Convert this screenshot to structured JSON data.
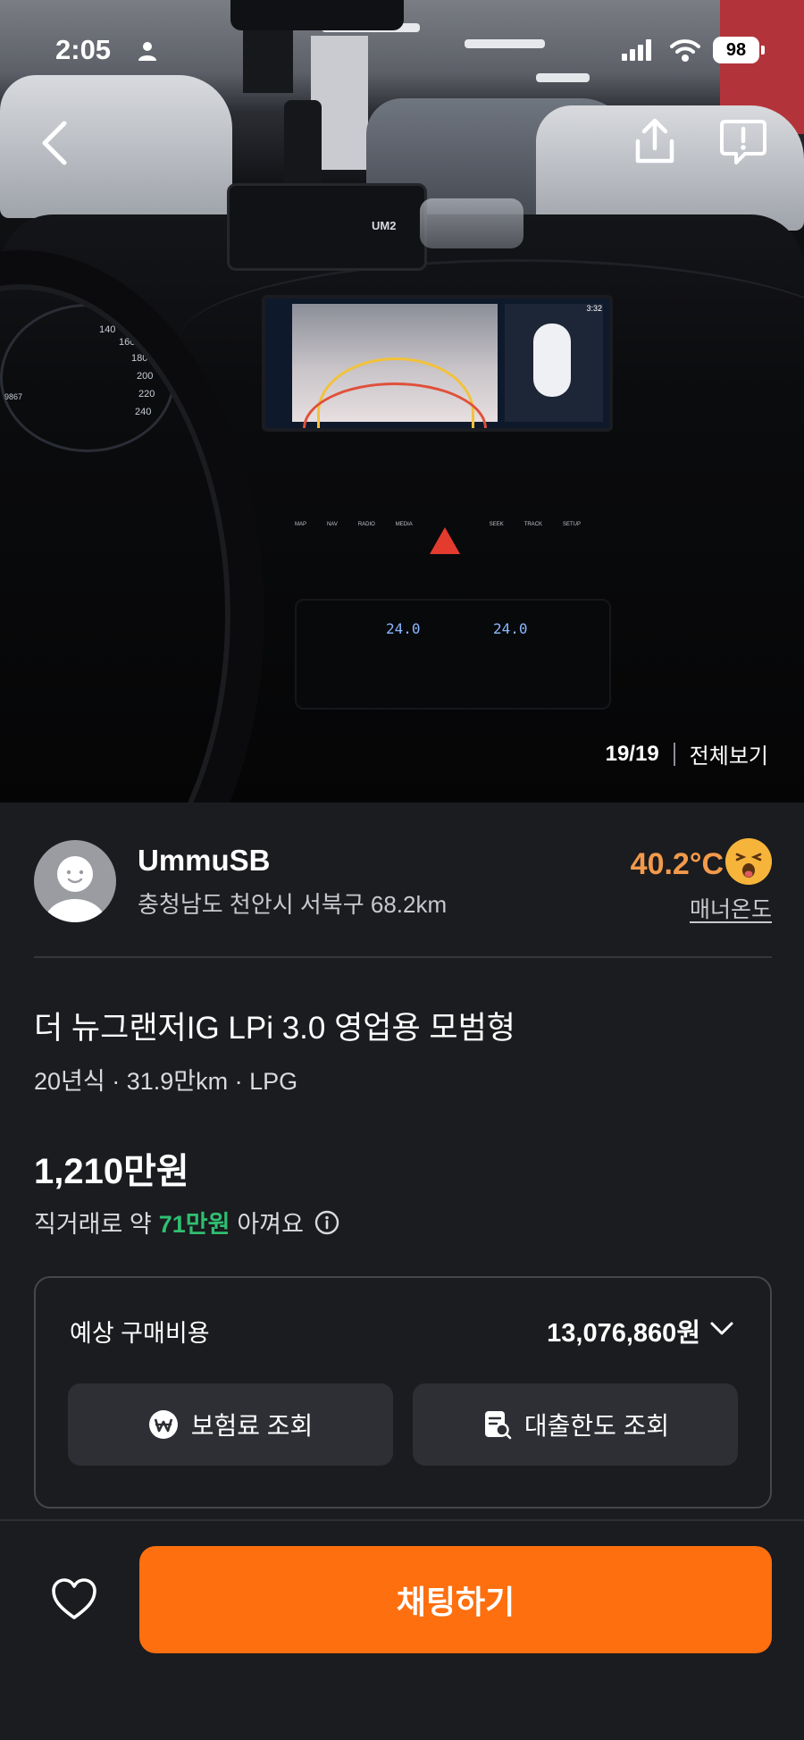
{
  "status_bar": {
    "time": "2:05",
    "battery": "98"
  },
  "photo": {
    "counter": "19/19",
    "view_all": "전체보기",
    "phone_label": "UM2",
    "screen_time": "3:32",
    "climate_left": "24.0",
    "climate_right": "24.0",
    "controls": [
      "MAP",
      "NAV",
      "RADIO",
      "MEDIA",
      "SEEK",
      "TRACK",
      "SETUP"
    ],
    "gauge_labels": [
      "140",
      "160",
      "180",
      "200",
      "220",
      "240"
    ],
    "odometer": "9867"
  },
  "seller": {
    "name": "UmmuSB",
    "location": "충청남도 천안시 서북구 68.2km",
    "temperature": "40.2°C",
    "manner_label": "매너온도"
  },
  "listing": {
    "title": "더 뉴그랜저IG LPi 3.0 영업용 모범형",
    "specs": "20년식 · 31.9만km · LPG",
    "price_number": "1,210",
    "price_unit": "만원",
    "saving_prefix": "직거래로 약",
    "saving_amount": "71만원",
    "saving_suffix": "아껴요"
  },
  "cost_card": {
    "label": "예상 구매비용",
    "amount": "13,076,860원",
    "insurance_button": "보험료 조회",
    "loan_button": "대출한도 조회"
  },
  "bottom_bar": {
    "chat_button": "채팅하기"
  },
  "colors": {
    "accent": "#fe6f0f",
    "temperature": "#f39a4b",
    "saving_green": "#2fbf71",
    "background": "#1b1c1f"
  }
}
